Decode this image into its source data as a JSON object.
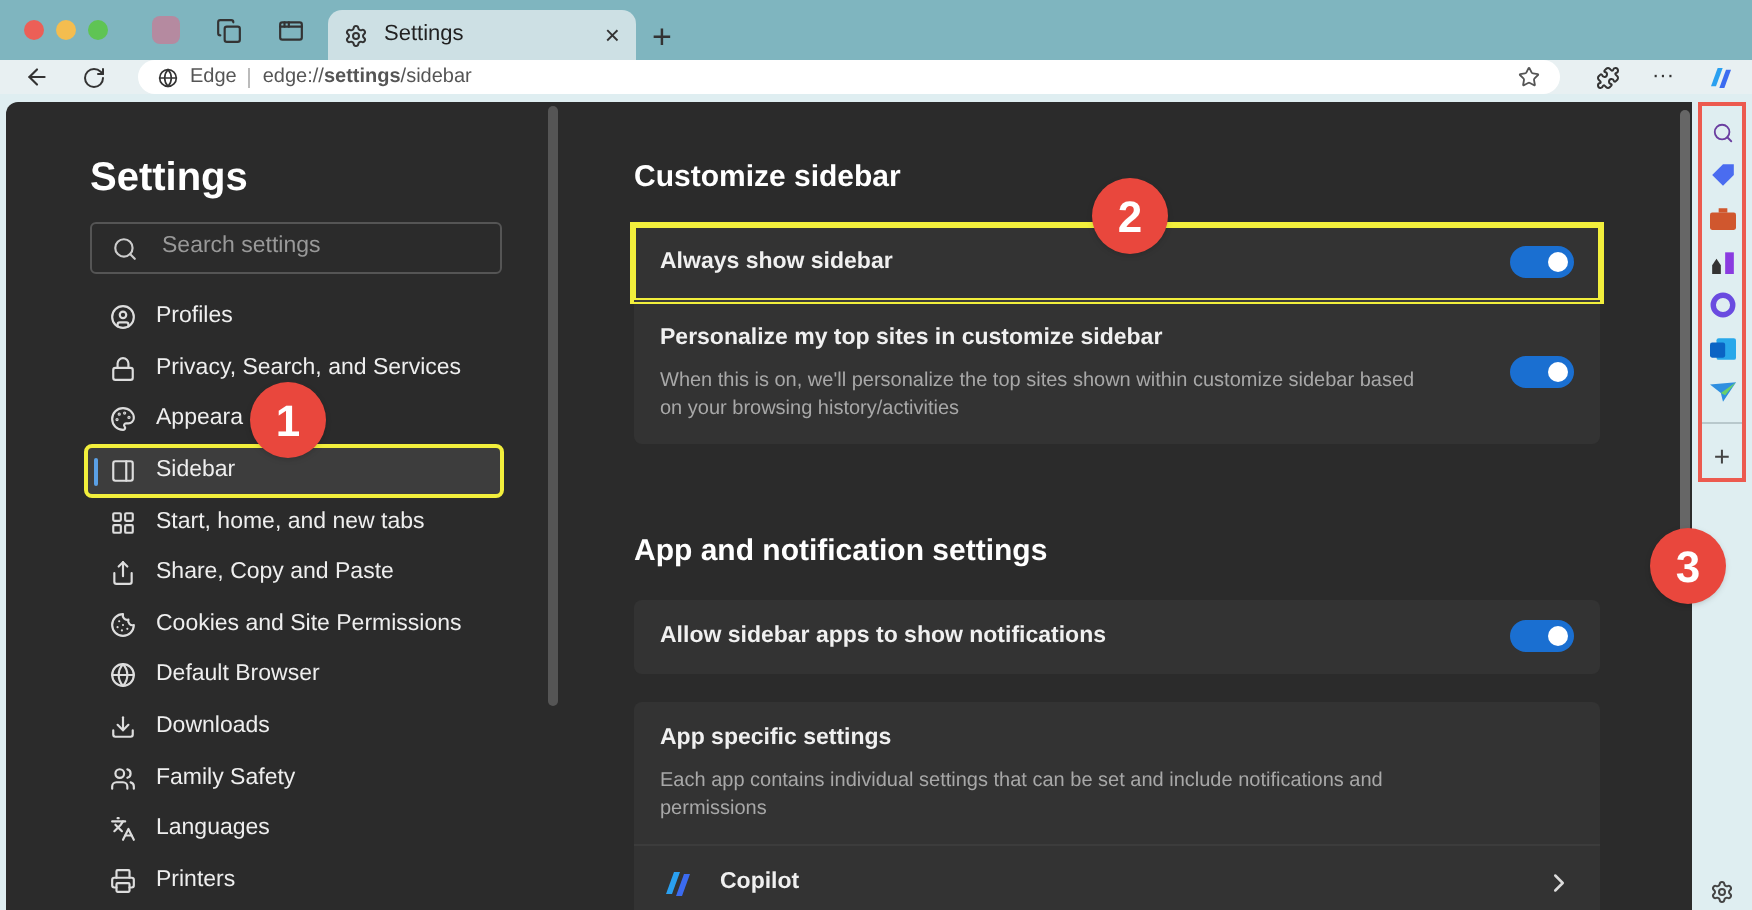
{
  "tab": {
    "title": "Settings",
    "close": "×",
    "new_tab": "+"
  },
  "address_bar": {
    "site": "Edge",
    "url": "edge://**settings**/sidebar"
  },
  "toolbar": {
    "more": "···"
  },
  "nav": {
    "title": "Settings",
    "search": {
      "placeholder": "Search settings"
    },
    "items": [
      {
        "label": "Profiles",
        "selected": false,
        "highlighted": false
      },
      {
        "label": "Privacy, Search, and Services",
        "selected": false,
        "highlighted": false
      },
      {
        "label": "Appeara",
        "selected": false,
        "highlighted": false
      },
      {
        "label": "Sidebar",
        "selected": true,
        "highlighted": true
      },
      {
        "label": "Start, home, and new tabs",
        "selected": false,
        "highlighted": false
      },
      {
        "label": "Share, Copy and Paste",
        "selected": false,
        "highlighted": false
      },
      {
        "label": "Cookies and Site Permissions",
        "selected": false,
        "highlighted": false
      },
      {
        "label": "Default Browser",
        "selected": false,
        "highlighted": false
      },
      {
        "label": "Downloads",
        "selected": false,
        "highlighted": false
      },
      {
        "label": "Family Safety",
        "selected": false,
        "highlighted": false
      },
      {
        "label": "Languages",
        "selected": false,
        "highlighted": false
      },
      {
        "label": "Printers",
        "selected": false,
        "highlighted": false
      }
    ]
  },
  "sections": [
    {
      "title": "Customize sidebar",
      "cards": [
        [
          {
            "label": "Always show sidebar",
            "on": true,
            "highlighted": true
          },
          {
            "label": "Personalize my top sites in customize sidebar",
            "description": "When this is on, we'll personalize the top sites shown within customize sidebar based on your browsing history/activities",
            "on": true,
            "highlighted": false
          }
        ]
      ]
    },
    {
      "title": "App and notification settings",
      "cards": [
        [
          {
            "label": "Allow sidebar apps to show notifications",
            "on": true,
            "highlighted": false
          }
        ],
        [
          {
            "label": "App specific settings",
            "description": "Each app contains individual settings that can be set and include notifications and permissions"
          },
          {
            "label": "Copilot",
            "kind": "link"
          }
        ]
      ]
    }
  ],
  "sidebar_apps": {
    "highlighted": true,
    "add": "+"
  },
  "annotations": [
    "1",
    "2",
    "3"
  ]
}
